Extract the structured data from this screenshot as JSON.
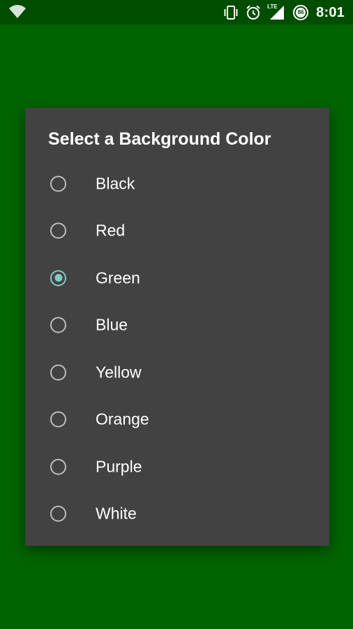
{
  "status_bar": {
    "time": "8:01",
    "network_label": "LTE",
    "battery_level": "86",
    "icons": [
      "wifi-unknown-icon",
      "vibrate-icon",
      "alarm-icon",
      "signal-icon",
      "battery-saver-icon"
    ]
  },
  "colors": {
    "background": "#006400",
    "status_bar": "#004d00",
    "dialog": "#424242",
    "accent": "#80cbc4"
  },
  "dialog": {
    "title": "Select a Background Color",
    "selected": "Green",
    "options": [
      {
        "label": "Black",
        "checked": false
      },
      {
        "label": "Red",
        "checked": false
      },
      {
        "label": "Green",
        "checked": true
      },
      {
        "label": "Blue",
        "checked": false
      },
      {
        "label": "Yellow",
        "checked": false
      },
      {
        "label": "Orange",
        "checked": false
      },
      {
        "label": "Purple",
        "checked": false
      },
      {
        "label": "White",
        "checked": false
      }
    ]
  }
}
